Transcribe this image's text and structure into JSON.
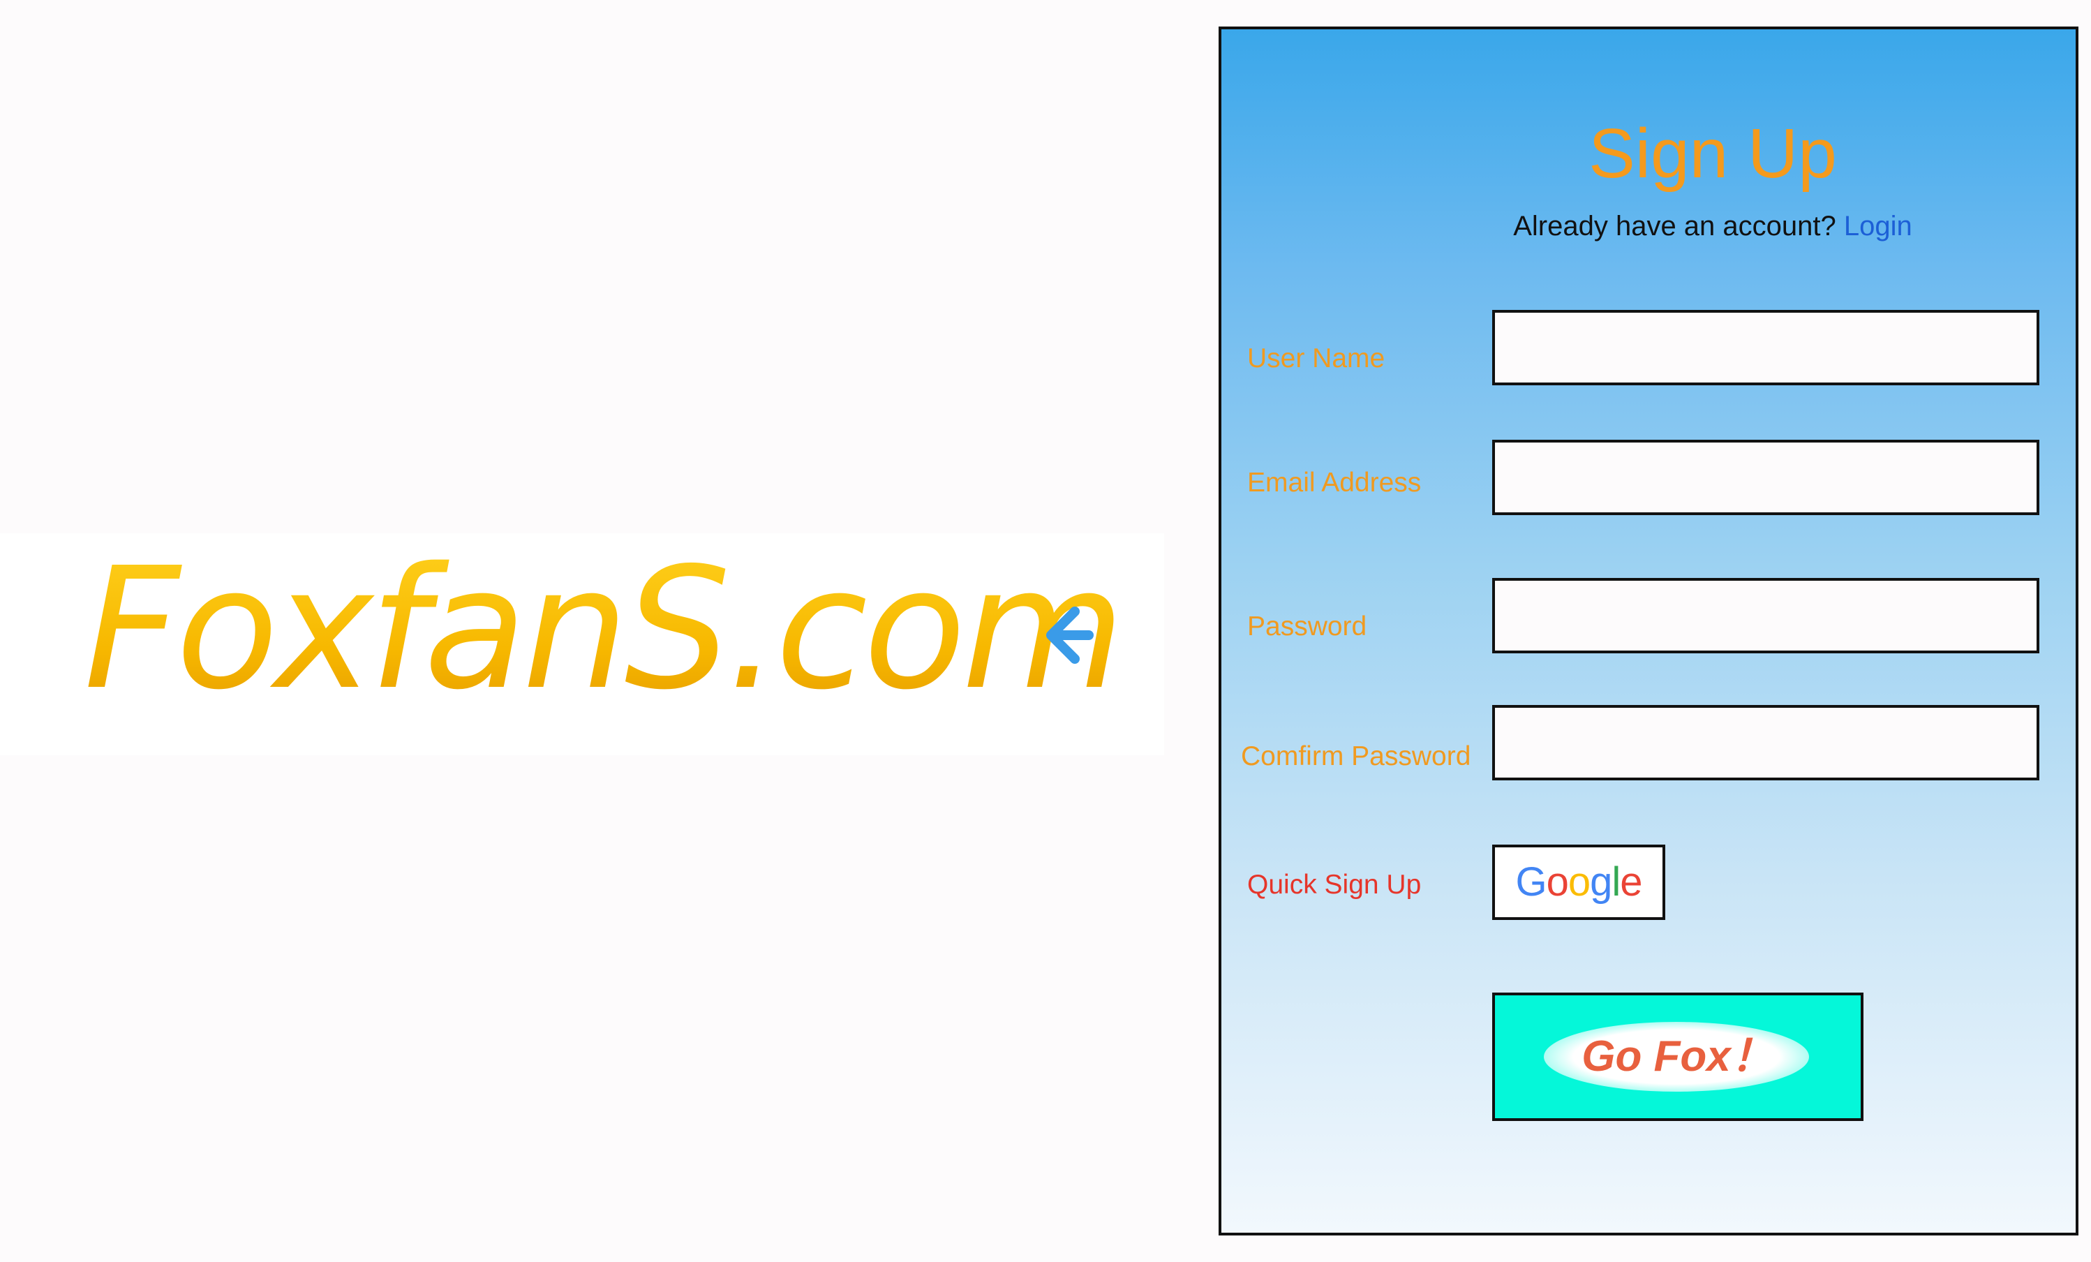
{
  "logo": {
    "text": "FoxfanS.com",
    "arrow_icon": "arrow-left-icon",
    "colors": {
      "text": "#f5b400",
      "arrow": "#3a9be8"
    }
  },
  "signup": {
    "title": "Sign Up",
    "already_text": "Already have an account?",
    "login_link": "Login",
    "fields": {
      "username": {
        "label": "User Name",
        "value": ""
      },
      "email": {
        "label": "Email Address",
        "value": ""
      },
      "password": {
        "label": "Password",
        "value": ""
      },
      "confirm": {
        "label": "Comfirm Password",
        "value": ""
      }
    },
    "quick_label": "Quick Sign Up",
    "google_button": {
      "icon": "google-logo-icon",
      "letters": [
        "G",
        "o",
        "o",
        "g",
        "l",
        "e"
      ],
      "letter_colors": [
        "#4285f4",
        "#ea4335",
        "#fbbc05",
        "#4285f4",
        "#34a853",
        "#ea4335"
      ]
    },
    "submit_label": "Go Fox！"
  },
  "colors": {
    "title": "#f49a1d",
    "field_label": "#f09a20",
    "quick_label": "#e6352a",
    "link": "#1c5fd6",
    "submit_bg": "#05f7d9",
    "submit_text": "#e8603e"
  }
}
